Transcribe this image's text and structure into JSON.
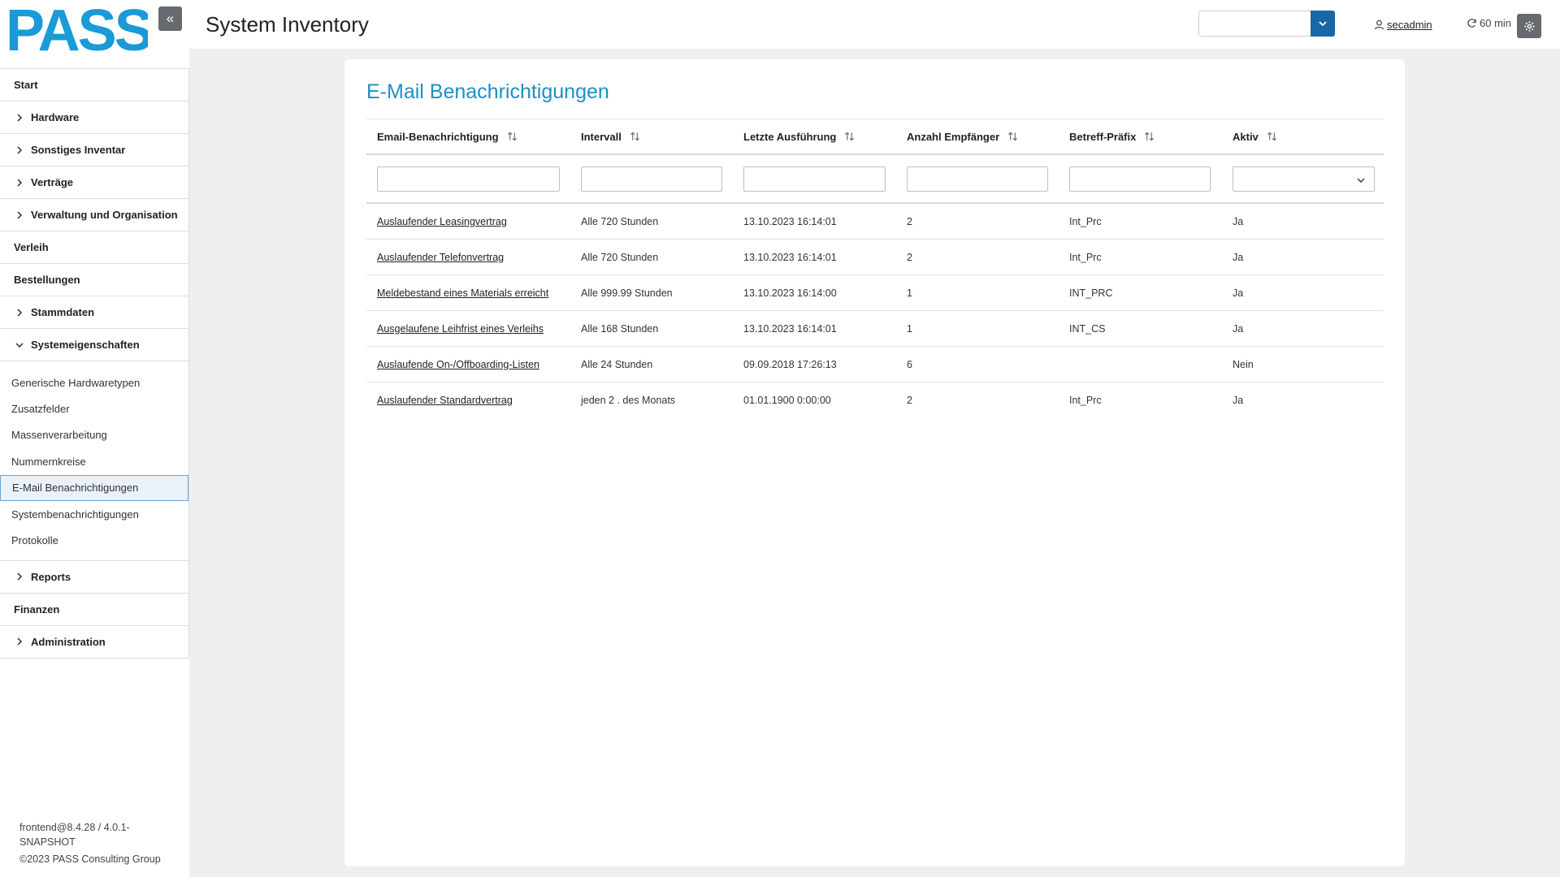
{
  "app": {
    "logo_text": "PASS",
    "page_title": "System Inventory",
    "brand_color": "#1a9ad6",
    "collapse_icon": "double-chevron-left-icon"
  },
  "header": {
    "user": "secadmin",
    "session_timer": "60 min",
    "select_value": ""
  },
  "sidebar": {
    "items": [
      {
        "label": "Start",
        "expandable": false
      },
      {
        "label": "Hardware",
        "expandable": true
      },
      {
        "label": "Sonstiges Inventar",
        "expandable": true
      },
      {
        "label": "Verträge",
        "expandable": true
      },
      {
        "label": "Verwaltung und Organisation",
        "expandable": true
      },
      {
        "label": "Verleih",
        "expandable": false
      },
      {
        "label": "Bestellungen",
        "expandable": false
      },
      {
        "label": "Stammdaten",
        "expandable": true
      },
      {
        "label": "Systemeigenschaften",
        "expandable": true,
        "expanded": true
      }
    ],
    "sub_items": [
      "Generische Hardwaretypen",
      "Zusatzfelder",
      "Massenverarbeitung",
      "Nummernkreise",
      "E-Mail Benachrichtigungen",
      "Systembenachrichtigungen",
      "Protokolle"
    ],
    "active_sub_item": "E-Mail Benachrichtigungen",
    "items_after": [
      {
        "label": "Reports",
        "expandable": true
      },
      {
        "label": "Finanzen",
        "expandable": false
      },
      {
        "label": "Administration",
        "expandable": true
      }
    ],
    "footer_version": "frontend@8.4.28 / 4.0.1-SNAPSHOT",
    "footer_copyright": "©2023 PASS Consulting Group"
  },
  "main": {
    "title": "E-Mail Benachrichtigungen",
    "columns": [
      "Email-Benachrichtigung",
      "Intervall",
      "Letzte Ausführung",
      "Anzahl Empfänger",
      "Betreff-Präfix",
      "Aktiv"
    ],
    "rows": [
      {
        "name": "Auslaufender Leasingvertrag",
        "interval": "Alle 720 Stunden",
        "last_run": "13.10.2023 16:14:01",
        "recipients": "2",
        "prefix": "Int_Prc",
        "active": "Ja"
      },
      {
        "name": "Auslaufender Telefonvertrag",
        "interval": "Alle 720 Stunden",
        "last_run": "13.10.2023 16:14:01",
        "recipients": "2",
        "prefix": "Int_Prc",
        "active": "Ja"
      },
      {
        "name": "Meldebestand eines Materials erreicht",
        "interval": "Alle 999.99 Stunden",
        "last_run": "13.10.2023 16:14:00",
        "recipients": "1",
        "prefix": "INT_PRC",
        "active": "Ja"
      },
      {
        "name": "Ausgelaufene Leihfrist eines Verleihs",
        "interval": "Alle 168 Stunden",
        "last_run": "13.10.2023 16:14:01",
        "recipients": "1",
        "prefix": "INT_CS",
        "active": "Ja"
      },
      {
        "name": "Auslaufende On-/Offboarding-Listen",
        "interval": "Alle 24 Stunden",
        "last_run": "09.09.2018 17:26:13",
        "recipients": "6",
        "prefix": "",
        "active": "Nein"
      },
      {
        "name": "Auslaufender Standardvertrag",
        "interval": "jeden 2 . des Monats",
        "last_run": "01.01.1900 0:00:00",
        "recipients": "2",
        "prefix": "Int_Prc",
        "active": "Ja"
      }
    ]
  }
}
